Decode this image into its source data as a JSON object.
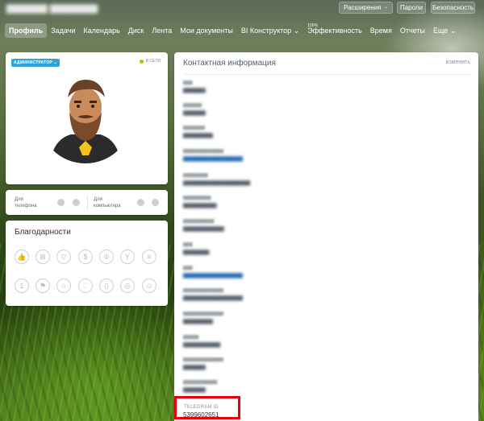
{
  "topbar": {
    "extensions_label": "Расширения",
    "passwords_label": "Пароли",
    "security_label": "Безопасность"
  },
  "nav": {
    "items": [
      "Профиль",
      "Задачи",
      "Календарь",
      "Диск",
      "Лента",
      "Мои документы",
      "BI Конструктор",
      "Эффективность",
      "Время",
      "Отчеты",
      "Еще"
    ],
    "efficiency_badge": "100%",
    "active": "Профиль"
  },
  "profile": {
    "role_badge": "АДМИНИСТРАТОР",
    "status": "В СЕТИ",
    "apps": [
      {
        "label": "Для телефона"
      },
      {
        "label": "Для компьютера"
      }
    ]
  },
  "thanks": {
    "title": "Благодарности",
    "badges": [
      "thumbs-up-icon",
      "gift-icon",
      "trophy-icon",
      "money-icon",
      "crown-icon",
      "cocktail-icon",
      "cake-icon",
      "number-one-icon",
      "flag-icon",
      "star-icon",
      "heart-icon",
      "beer-icon",
      "medal-icon",
      "smile-icon"
    ]
  },
  "contact": {
    "title": "Контактная информация",
    "edit_label": "изменить",
    "telegram": {
      "label": "TELEGRAM ID",
      "value": "5399602651"
    }
  },
  "colors": {
    "accent": "#2fa6d9",
    "online": "#9dcf00",
    "highlight": "#e8000b"
  }
}
